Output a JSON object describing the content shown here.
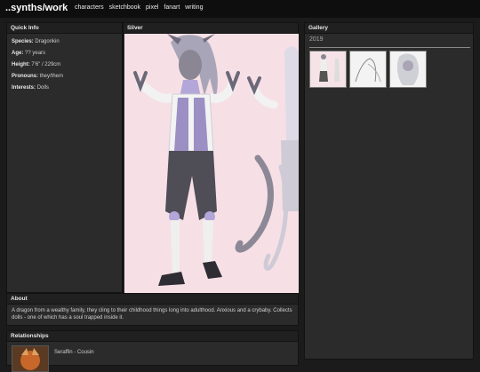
{
  "site": {
    "title": "..synths/work"
  },
  "nav": [
    "characters",
    "sketchbook",
    "pixel",
    "fanart",
    "writing"
  ],
  "quick_info": {
    "title": "Quick Info",
    "rows": [
      {
        "key": "Species:",
        "value": "Dragonkin"
      },
      {
        "key": "Age:",
        "value": "?? years"
      },
      {
        "key": "Height:",
        "value": "7'6\" / 229cm"
      },
      {
        "key": "Pronouns:",
        "value": "they/them"
      },
      {
        "key": "Interests:",
        "value": "Dolls"
      }
    ]
  },
  "character": {
    "name": "Silver"
  },
  "gallery": {
    "title": "Gallery",
    "year": "2019",
    "thumb_count": 3
  },
  "about": {
    "title": "About",
    "text": "A dragon from a wealthy family, they cling to their childhood things long into adulthood. Anxious and a crybaby. Collects dolls - one of which has a soul trapped inside it."
  },
  "relationships": {
    "title": "Relationships",
    "items": [
      {
        "label": "Seraffin - Cousin"
      }
    ]
  }
}
